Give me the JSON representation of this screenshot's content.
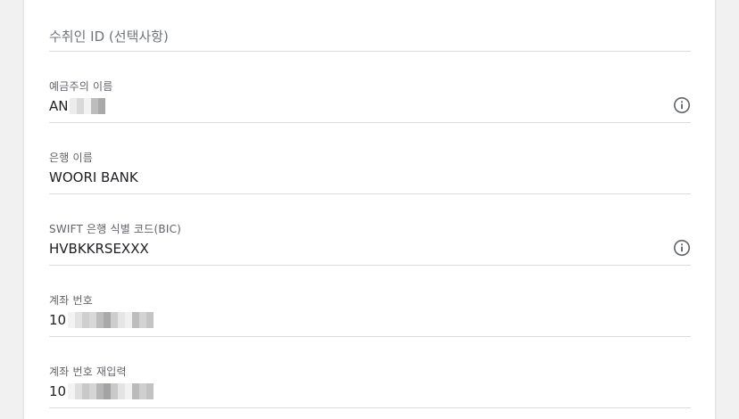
{
  "form": {
    "recipient_id": {
      "placeholder": "수취인 ID (선택사항)"
    },
    "holder_name": {
      "label": "예금주의 이름",
      "value": "AN",
      "info_icon": "info-circle-icon"
    },
    "bank_name": {
      "label": "은행 이름",
      "value": "WOORI BANK"
    },
    "swift": {
      "label": "SWIFT 은행 식별 코드(BIC)",
      "value": "HVBKKRSEXXX",
      "info_icon": "info-circle-icon"
    },
    "account_number": {
      "label": "계좌 번호",
      "value": "10"
    },
    "account_confirm": {
      "label": "계좌 번호 재입력",
      "value": "10"
    }
  },
  "colors": {
    "label": "#5f6368",
    "text": "#202124",
    "divider": "#dadce0",
    "icon": "#5f6368",
    "background": "#f1f1f1"
  }
}
